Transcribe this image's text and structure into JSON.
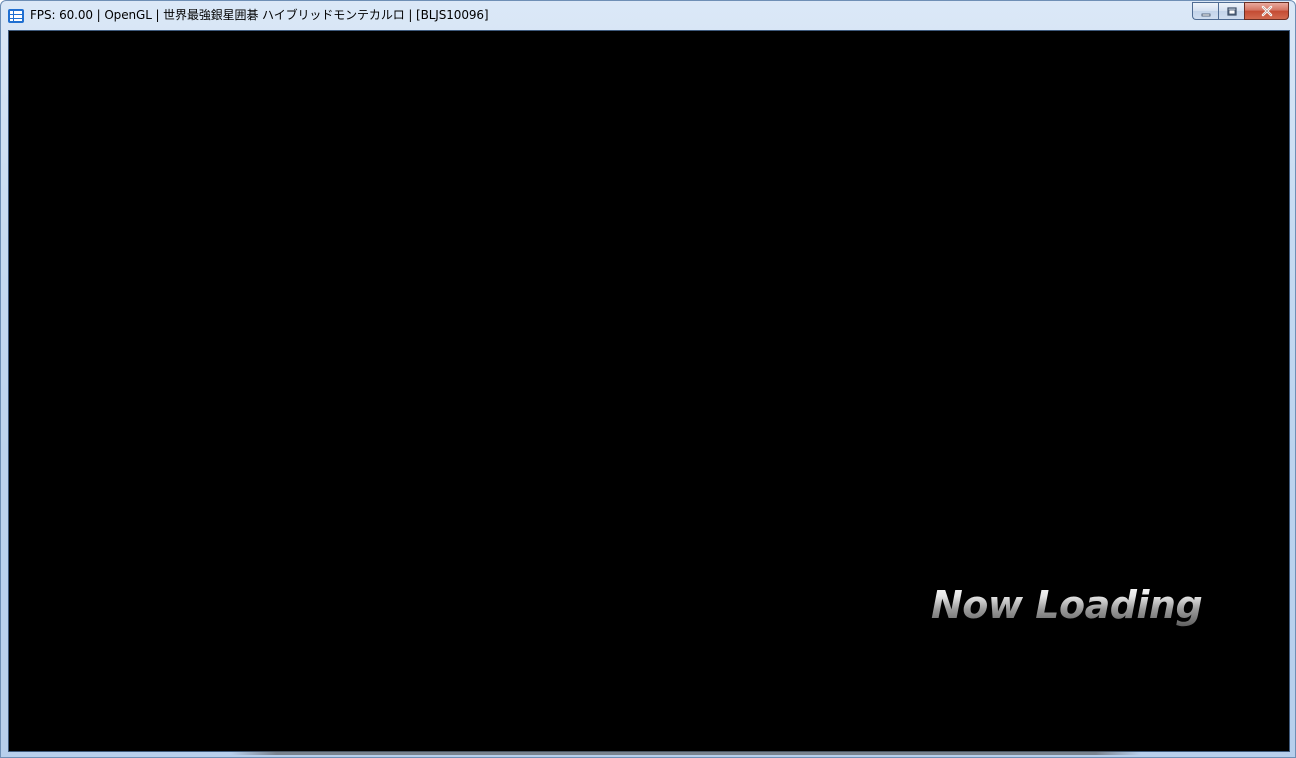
{
  "window": {
    "title": "FPS: 60.00 | OpenGL | 世界最強銀星囲碁 ハイブリッドモンテカルロ | [BLJS10096]",
    "icon": "rpcs3-app-icon",
    "buttons": {
      "minimize": "minimize-icon",
      "maximize": "maximize-icon",
      "close": "close-icon"
    }
  },
  "game": {
    "background_color": "#000000",
    "loading_text": "Now Loading"
  }
}
